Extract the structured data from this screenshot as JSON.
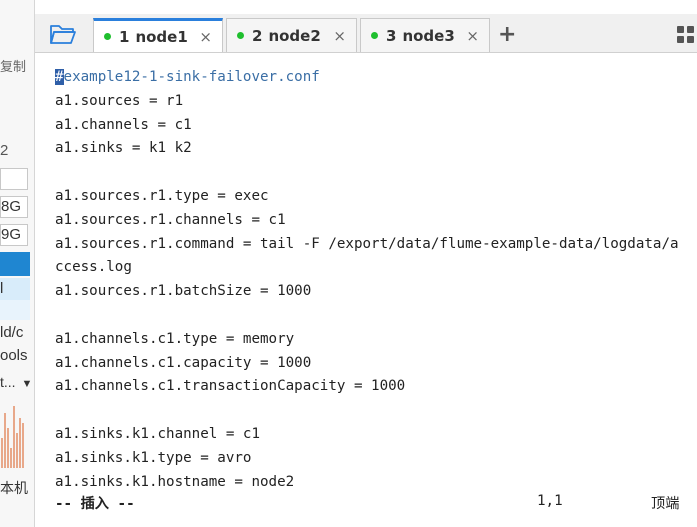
{
  "left_pane": {
    "fragments": [
      "复制",
      "2",
      "8G",
      "9G",
      "l",
      "ld/c",
      "ools",
      "t...",
      "本机"
    ]
  },
  "tabs": [
    {
      "num": "1",
      "label": "node1",
      "status_color": "#1fbf2e",
      "active": true
    },
    {
      "num": "2",
      "label": "node2",
      "status_color": "#1fbf2e",
      "active": false
    },
    {
      "num": "3",
      "label": "node3",
      "status_color": "#1fbf2e",
      "active": false
    }
  ],
  "tab_close_glyph": "×",
  "add_tab_glyph": "+",
  "editor": {
    "lines": [
      "#example12-1-sink-failover.conf",
      "a1.sources = r1",
      "a1.channels = c1",
      "a1.sinks = k1 k2",
      "",
      "a1.sources.r1.type = exec",
      "a1.sources.r1.channels = c1",
      "a1.sources.r1.command = tail -F /export/data/flume-example-data/logdata/a",
      "ccess.log",
      "a1.sources.r1.batchSize = 1000",
      "",
      "a1.channels.c1.type = memory",
      "a1.channels.c1.capacity = 1000",
      "a1.channels.c1.transactionCapacity = 1000",
      "",
      "a1.sinks.k1.channel = c1",
      "a1.sinks.k1.type = avro",
      "a1.sinks.k1.hostname = node2"
    ],
    "status_mode": "-- 插入 --",
    "status_position": "1,1",
    "status_where": "顶端"
  },
  "colors": {
    "accent": "#2a7fdc",
    "online": "#1fbf2e",
    "cursor": "#2f5fa8"
  },
  "icons": [
    "folder-icon",
    "close-icon",
    "plus-icon",
    "grid-icon",
    "dropdown-icon"
  ]
}
